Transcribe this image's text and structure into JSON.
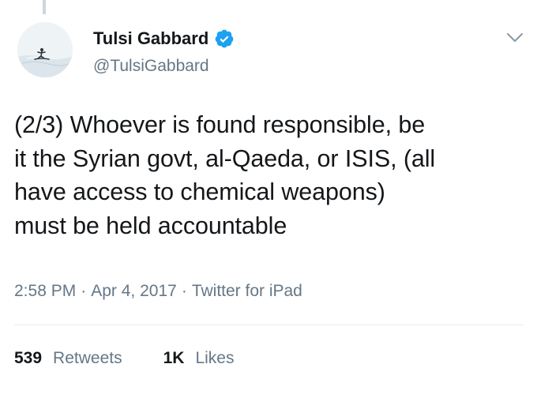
{
  "tweet": {
    "author": {
      "name": "Tulsi Gabbard",
      "handle": "@TulsiGabbard",
      "verified_icon": "verified-badge-icon",
      "avatar_icon": "surfer-avatar"
    },
    "menu_icon": "chevron-down-icon",
    "text_lines": [
      "(2/3) Whoever is found responsible, be",
      "it the Syrian govt, al-Qaeda, or ISIS, (all",
      "have access to chemical weapons)",
      "must be held accountable"
    ],
    "meta": {
      "time": "2:58 PM",
      "date": "Apr 4, 2017",
      "source": "Twitter for iPad",
      "separator": "·"
    },
    "stats": {
      "retweets_count": "539",
      "retweets_label": "Retweets",
      "likes_count": "1K",
      "likes_label": "Likes"
    }
  },
  "colors": {
    "text": "#14171a",
    "secondary": "#657786",
    "verified": "#1da1f2",
    "divider": "#e6ecf0",
    "thread_line": "#ccd6dd"
  }
}
